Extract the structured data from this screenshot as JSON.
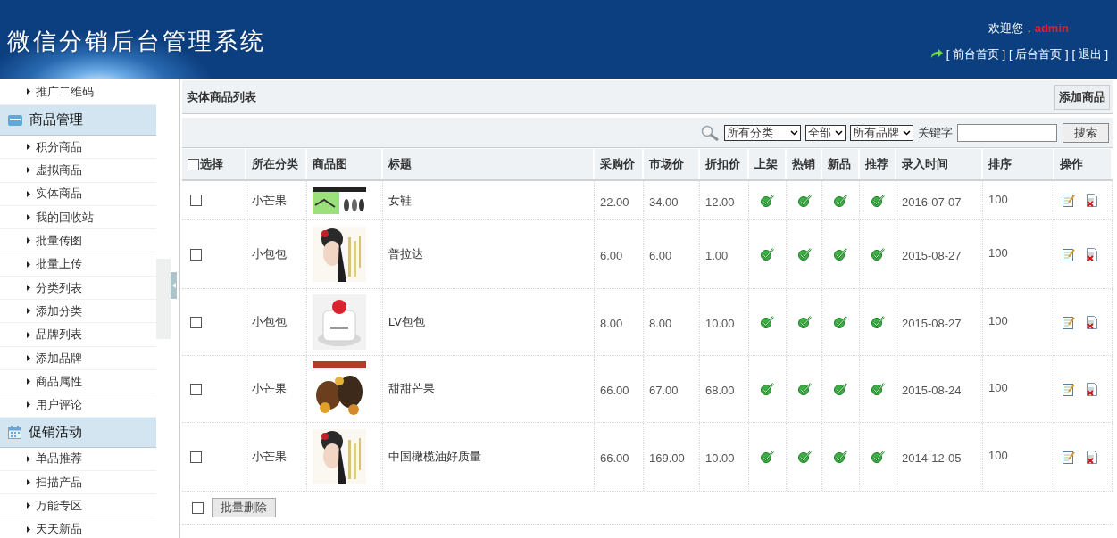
{
  "header": {
    "title": "微信分销后台管理系统",
    "welcome": "欢迎您，",
    "user": "admin",
    "links": [
      "[ 前台首页 ]",
      "[ 后台首页 ]",
      "[ 退出 ]"
    ]
  },
  "sidebar": [
    {
      "items": [
        "推广二维码"
      ]
    },
    {
      "title": "商品管理",
      "items": [
        "积分商品",
        "虚拟商品",
        "实体商品",
        "我的回收站",
        "批量传图",
        "批量上传",
        "分类列表",
        "添加分类",
        "品牌列表",
        "添加品牌",
        "商品属性",
        "用户评论"
      ]
    },
    {
      "title": "促销活动",
      "items": [
        "单品推荐",
        "扫描产品",
        "万能专区",
        "天天新品"
      ]
    }
  ],
  "page": {
    "title": "实体商品列表",
    "add_button": "添加商品"
  },
  "filters": {
    "selects": [
      "所有分类",
      "全部",
      "所有品牌"
    ],
    "keyword_label": "关键字",
    "search_button": "搜索"
  },
  "table": {
    "columns": [
      "选择",
      "所在分类",
      "商品图",
      "标题",
      "采购价",
      "市场价",
      "折扣价",
      "上架",
      "热销",
      "新品",
      "推荐",
      "录入时间",
      "排序",
      "操作"
    ],
    "select_all_checked": false,
    "rows": [
      {
        "checked": false,
        "category": "小芒果",
        "title": "女鞋",
        "purchase": "22.00",
        "market": "34.00",
        "discount": "12.00",
        "on_shelf": true,
        "hot": true,
        "new": true,
        "recommended": true,
        "date": "2016-07-07",
        "sort": "100"
      },
      {
        "checked": false,
        "category": "小包包",
        "title": "普拉达",
        "purchase": "6.00",
        "market": "6.00",
        "discount": "1.00",
        "on_shelf": true,
        "hot": true,
        "new": true,
        "recommended": true,
        "date": "2015-08-27",
        "sort": "100"
      },
      {
        "checked": false,
        "category": "小包包",
        "title": "LV包包",
        "purchase": "8.00",
        "market": "8.00",
        "discount": "10.00",
        "on_shelf": true,
        "hot": true,
        "new": true,
        "recommended": true,
        "date": "2015-08-27",
        "sort": "100"
      },
      {
        "checked": false,
        "category": "小芒果",
        "title": "甜甜芒果",
        "purchase": "66.00",
        "market": "67.00",
        "discount": "68.00",
        "on_shelf": true,
        "hot": true,
        "new": true,
        "recommended": true,
        "date": "2015-08-24",
        "sort": "100"
      },
      {
        "checked": false,
        "category": "小芒果",
        "title": "中国橄榄油好质量",
        "purchase": "66.00",
        "market": "169.00",
        "discount": "10.00",
        "on_shelf": true,
        "hot": true,
        "new": true,
        "recommended": true,
        "date": "2014-12-05",
        "sort": "100"
      }
    ],
    "footer": {
      "checked": false,
      "batch_delete": "批量删除"
    }
  }
}
